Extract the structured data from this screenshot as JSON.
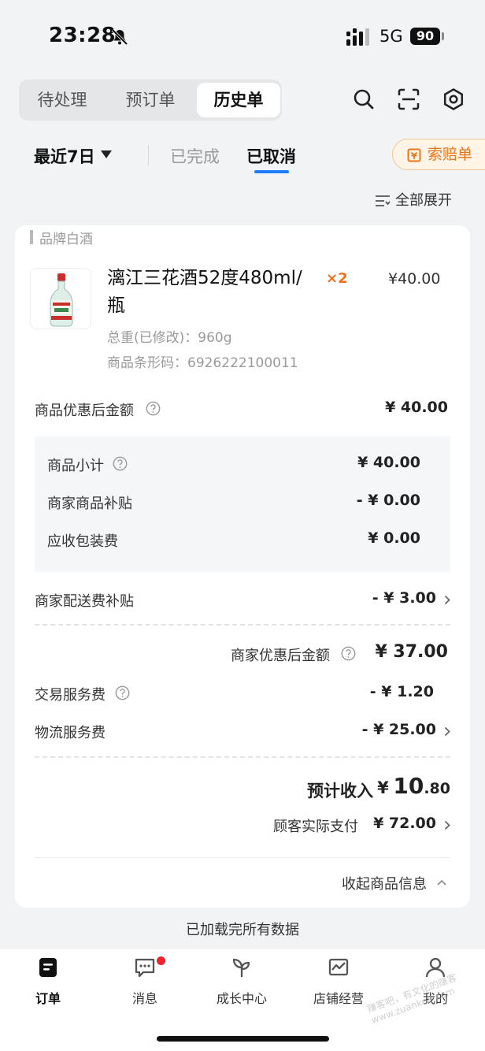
{
  "status_bar": {
    "time": "23:28",
    "network": "5G",
    "battery": "90"
  },
  "header": {
    "tabs": [
      {
        "label": "待处理",
        "active": false
      },
      {
        "label": "预订单",
        "active": false
      },
      {
        "label": "历史单",
        "active": true
      }
    ]
  },
  "filters": {
    "range": "最近7日",
    "sub_tabs": [
      {
        "label": "已完成",
        "active": false
      },
      {
        "label": "已取消",
        "active": true
      }
    ],
    "claim_label": "索赔单",
    "expand_all": "全部展开"
  },
  "order": {
    "category": "品牌白酒",
    "product": {
      "name": "漓江三花酒52度480ml/瓶",
      "qty": "×2",
      "price": "¥40.00",
      "weight": "总重(已修改)：960g",
      "barcode": "商品条形码：6926222100011"
    },
    "after_discount": {
      "label": "商品优惠后金额",
      "value": "¥ 40.00"
    },
    "breakdown": [
      {
        "label": "商品小计",
        "value": "¥ 40.00"
      },
      {
        "label": "商家商品补贴",
        "value": "- ¥ 0.00"
      },
      {
        "label": "应收包装费",
        "value": "¥ 0.00"
      }
    ],
    "delivery_subsidy": {
      "label": "商家配送费补贴",
      "value": "- ¥ 3.00"
    },
    "merchant_after_discount": {
      "label": "商家优惠后金额",
      "value": "¥ 37.00"
    },
    "service_fee": {
      "label": "交易服务费",
      "value": "- ¥ 1.20"
    },
    "logistics_fee": {
      "label": "物流服务费",
      "value": "- ¥ 25.00"
    },
    "expected_income": {
      "label": "预计收入",
      "currency": "¥",
      "integer": "10",
      "decimal": ".80"
    },
    "customer_paid": {
      "label": "顾客实际支付",
      "value": "¥ 72.00"
    },
    "collapse_label": "收起商品信息"
  },
  "footer_text": "已加载完所有数据",
  "bottom_nav": [
    {
      "label": "订单",
      "icon": "order-icon",
      "active": true
    },
    {
      "label": "消息",
      "icon": "message-icon",
      "active": false,
      "badge": true
    },
    {
      "label": "成长中心",
      "icon": "sprout-icon",
      "active": false
    },
    {
      "label": "店铺经营",
      "icon": "chart-icon",
      "active": false
    },
    {
      "label": "我的",
      "icon": "user-icon",
      "active": false
    }
  ],
  "watermark": "赚客吧，有文化的赚客 www.zuanke8.com",
  "colors": {
    "accent": "#1e7cf5",
    "orange": "#f2711c",
    "badge": "#f2222d"
  }
}
